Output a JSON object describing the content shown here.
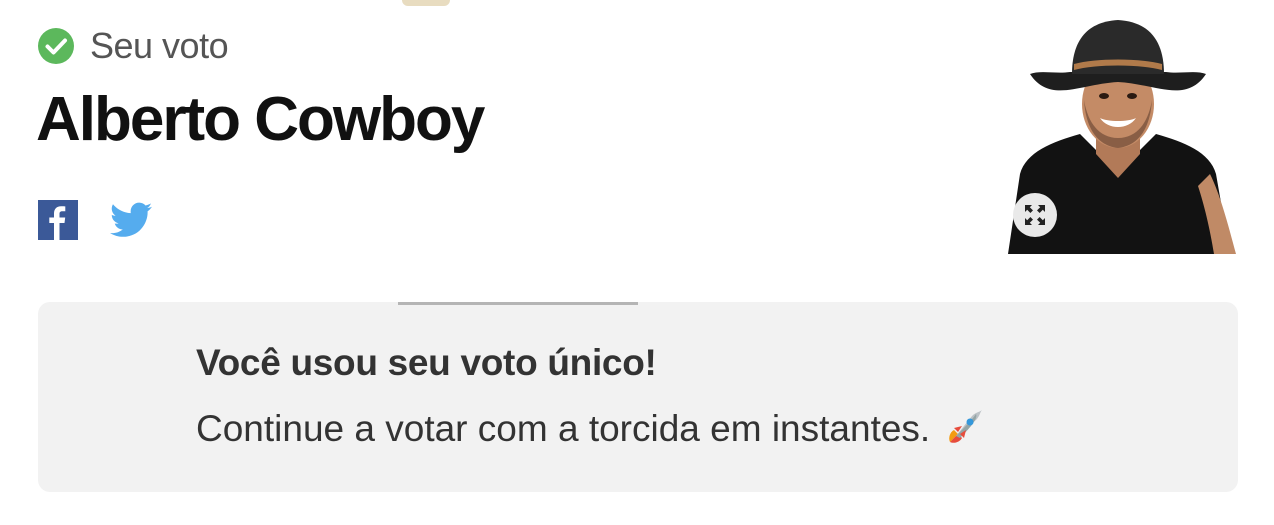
{
  "vote": {
    "status_label": "Seu voto",
    "candidate_name": "Alberto Cowboy"
  },
  "share": {
    "facebook_icon": "facebook-icon",
    "twitter_icon": "twitter-icon"
  },
  "photo": {
    "expand_icon": "expand-icon"
  },
  "notice": {
    "title": "Você usou seu voto único!",
    "message": "Continue a votar com a torcida em instantes.",
    "emoji_icon": "rocket-icon"
  },
  "colors": {
    "check_green": "#5cb85c",
    "facebook_blue": "#3b5998",
    "twitter_blue": "#55acee",
    "notice_bg": "#f2f2f2"
  }
}
